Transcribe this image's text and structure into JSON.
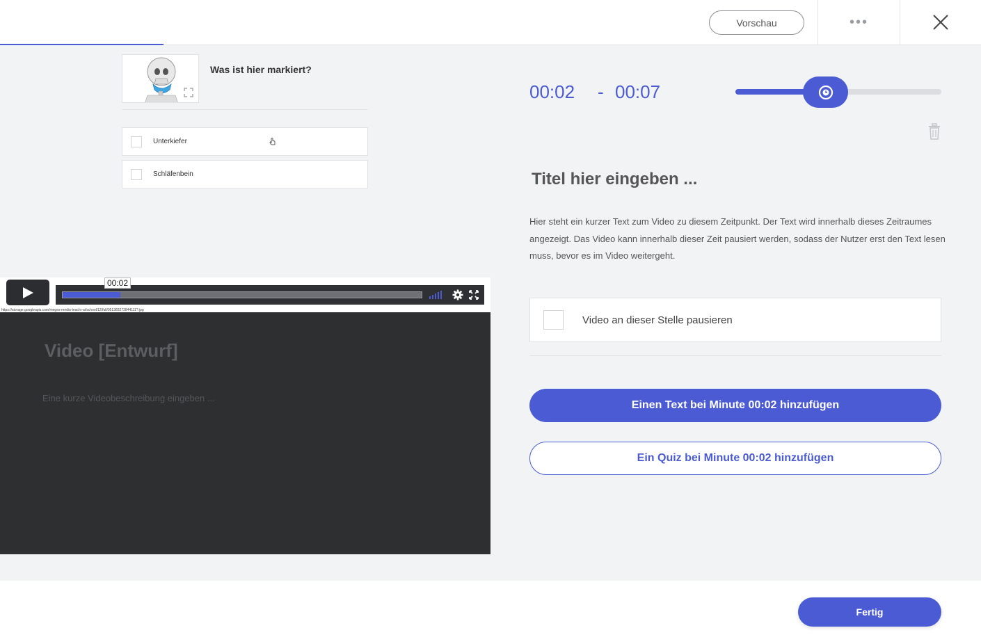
{
  "header": {
    "preview_label": "Vorschau",
    "more_label": "•••",
    "editor_progress": 0.167
  },
  "quiz": {
    "question": "Was ist hier markiert?",
    "answers": [
      {
        "label": "Unterkiefer"
      },
      {
        "label": "Schläfenbein"
      }
    ]
  },
  "player": {
    "current_time": "00:02",
    "progress": 0.16,
    "source_url": "https://storage.googleapis.com/mnges-media-teachr-ai/school/12/full/051383272844111?.jpg"
  },
  "video": {
    "title": "Video [Entwurf]",
    "description_placeholder": "Eine kurze Videobeschreibung eingeben ..."
  },
  "segment": {
    "start": "00:02",
    "separator": "-",
    "end": "00:07",
    "slider_position": 0.45,
    "title_placeholder": "Titel hier eingeben ...",
    "description": "Hier steht ein kurzer Text zum Video zu diesem Zeitpunkt. Der Text wird innerhalb dieses Zeitraumes angezeigt. Das Video kann innerhalb dieser Zeit pausiert werden, sodass der Nutzer erst den Text lesen muss, bevor es im Video weitergeht.",
    "pause_label": "Video an dieser Stelle pausieren",
    "add_text_label": "Einen Text bei Minute 00:02 hinzufügen",
    "add_quiz_label": "Ein Quiz bei Minute 00:02 hinzufügen"
  },
  "footer": {
    "done_label": "Fertig"
  },
  "colors": {
    "accent": "#4a5bd4",
    "panel_bg": "#f2f3f5",
    "video_bg": "#2e2f31"
  }
}
